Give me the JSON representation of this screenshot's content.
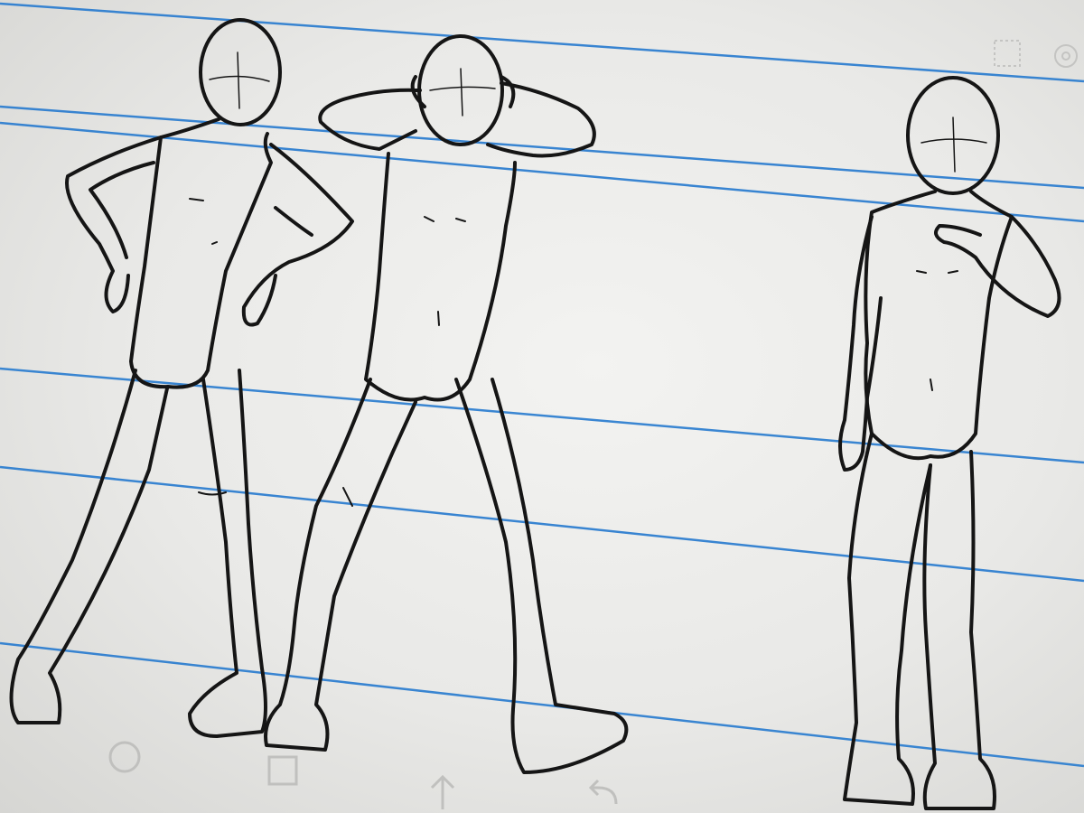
{
  "scene": {
    "kind": "photo of a tablet screen showing a sketch of three mannequin figures on ruled paper",
    "paper_color": "#efefed",
    "rule_color": "#2f7fd0",
    "ink_color": "#151515"
  },
  "figures": [
    {
      "pose": "hands-on-hips"
    },
    {
      "pose": "hands-behind-head"
    },
    {
      "pose": "hand-on-chest"
    }
  ],
  "nav_bar": {
    "icons": [
      "home-circle-icon",
      "recents-square-icon",
      "up-arrow-icon",
      "back-arrow-icon"
    ]
  },
  "toolbar": {
    "icons": [
      "selection-square-icon",
      "settings-gear-icon"
    ]
  }
}
